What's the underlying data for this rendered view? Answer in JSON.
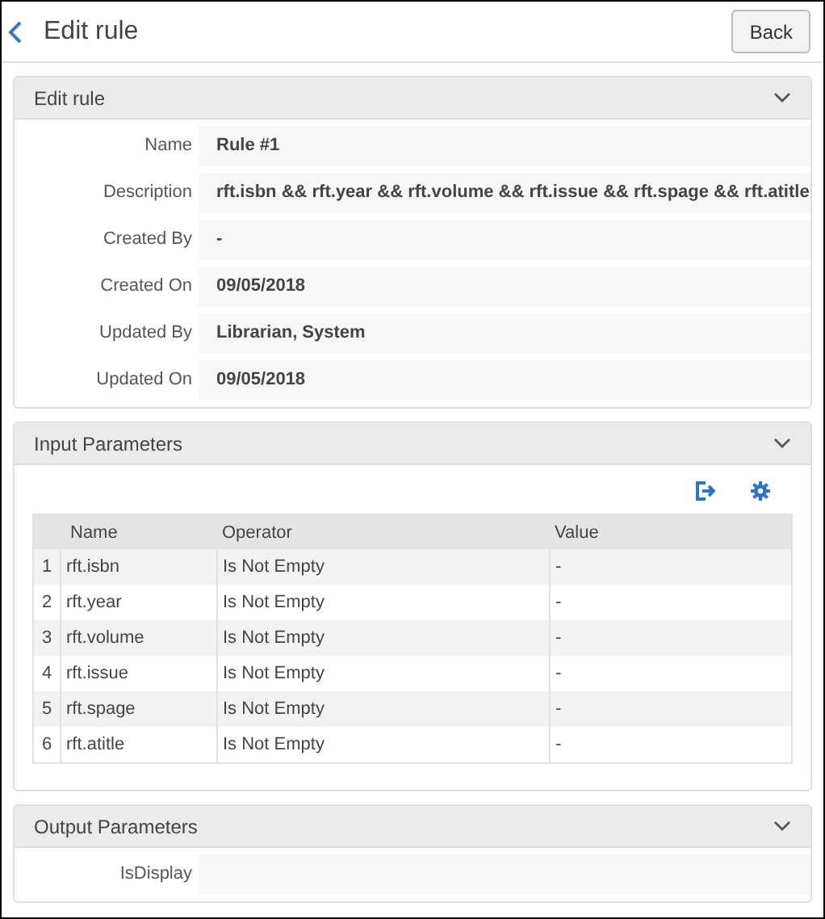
{
  "page": {
    "title": "Edit rule",
    "back_button": "Back"
  },
  "sections": [
    {
      "kind": "fields",
      "title": "Edit rule",
      "fields": [
        {
          "label": "Name",
          "value": "Rule #1"
        },
        {
          "label": "Description",
          "value": "rft.isbn && rft.year && rft.volume && rft.issue && rft.spage && rft.atitle"
        },
        {
          "label": "Created By",
          "value": "-"
        },
        {
          "label": "Created On",
          "value": "09/05/2018"
        },
        {
          "label": "Updated By",
          "value": "Librarian, System"
        },
        {
          "label": "Updated On",
          "value": "09/05/2018"
        }
      ]
    },
    {
      "kind": "table",
      "title": "Input Parameters",
      "table": {
        "columns": [
          "Name",
          "Operator",
          "Value"
        ],
        "rows": [
          {
            "index": "1",
            "cells": [
              "rft.isbn",
              "Is Not Empty",
              "-"
            ]
          },
          {
            "index": "2",
            "cells": [
              "rft.year",
              "Is Not Empty",
              "-"
            ]
          },
          {
            "index": "3",
            "cells": [
              "rft.volume",
              "Is Not Empty",
              "-"
            ]
          },
          {
            "index": "4",
            "cells": [
              "rft.issue",
              "Is Not Empty",
              "-"
            ]
          },
          {
            "index": "5",
            "cells": [
              "rft.spage",
              "Is Not Empty",
              "-"
            ]
          },
          {
            "index": "6",
            "cells": [
              "rft.atitle",
              "Is Not Empty",
              "-"
            ]
          }
        ]
      }
    },
    {
      "kind": "fields",
      "title": "Output Parameters",
      "fields": [
        {
          "label": "IsDisplay"
        }
      ]
    }
  ]
}
